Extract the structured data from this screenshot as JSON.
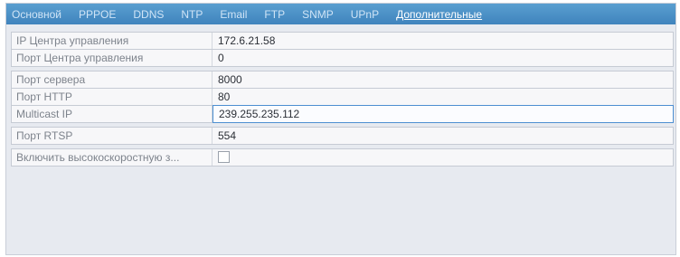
{
  "tabs": [
    {
      "label": "Основной",
      "active": false
    },
    {
      "label": "PPPOE",
      "active": false
    },
    {
      "label": "DDNS",
      "active": false
    },
    {
      "label": "NTP",
      "active": false
    },
    {
      "label": "Email",
      "active": false
    },
    {
      "label": "FTP",
      "active": false
    },
    {
      "label": "SNMP",
      "active": false
    },
    {
      "label": "UPnP",
      "active": false
    },
    {
      "label": "Дополнительные",
      "active": true
    }
  ],
  "fields": {
    "mgmt_center_ip": {
      "label": "IP Центра управления",
      "value": "172.6.21.58"
    },
    "mgmt_center_port": {
      "label": "Порт Центра управления",
      "value": "0"
    },
    "server_port": {
      "label": "Порт сервера",
      "value": "8000"
    },
    "http_port": {
      "label": "Порт HTTP",
      "value": "80"
    },
    "multicast_ip": {
      "label": "Multicast IP",
      "value": "239.255.235.112"
    },
    "rtsp_port": {
      "label": "Порт RTSP",
      "value": "554"
    },
    "high_speed_download": {
      "label": "Включить высокоскоростную з...",
      "checked": false
    }
  },
  "colors": {
    "tabbar": "#4a90c8",
    "focus_border": "#4d8fd1"
  }
}
